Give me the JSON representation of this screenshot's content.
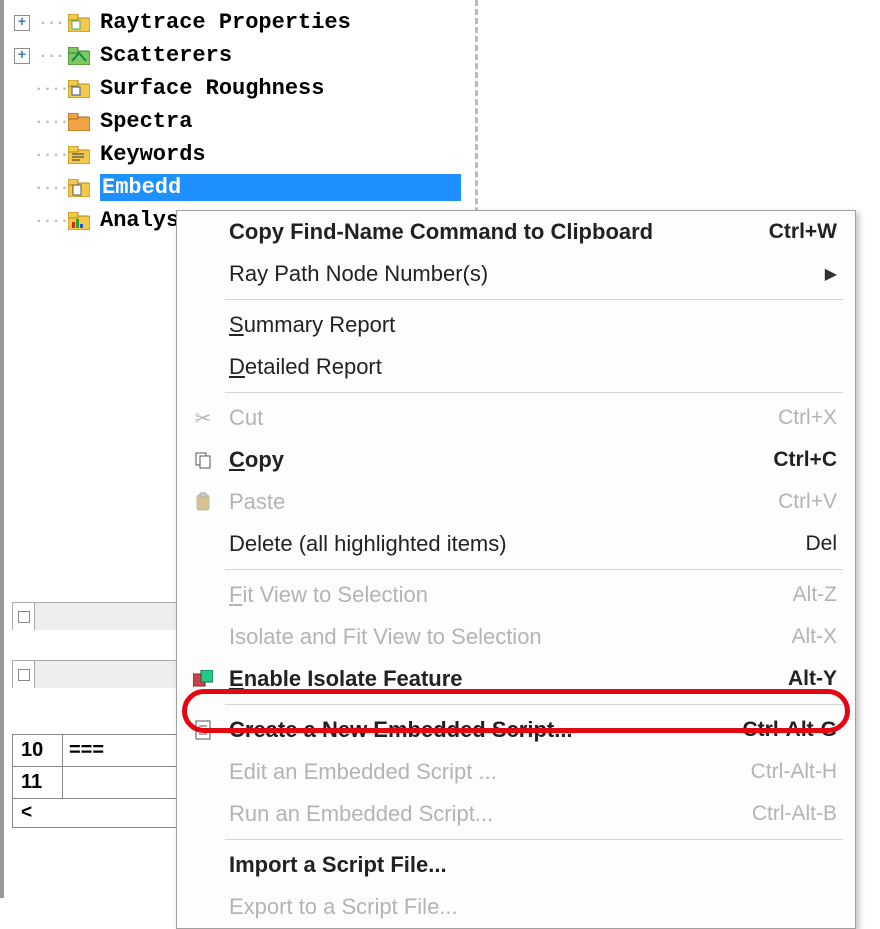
{
  "tree": {
    "items": [
      {
        "label": "Raytrace Properties",
        "expandable": true,
        "icon": "folder-yellow-doc"
      },
      {
        "label": "Scatterers",
        "expandable": true,
        "icon": "folder-green"
      },
      {
        "label": "Surface Roughness",
        "expandable": false,
        "icon": "folder-yellow-doc"
      },
      {
        "label": "Spectra",
        "expandable": false,
        "icon": "folder-orange"
      },
      {
        "label": "Keywords",
        "expandable": false,
        "icon": "folder-yellow-lines"
      },
      {
        "label": "Embedded Scripts",
        "expandable": false,
        "icon": "folder-script",
        "selected": true,
        "visible_label": "Embedd"
      },
      {
        "label": "Analysis",
        "expandable": false,
        "icon": "folder-chart",
        "visible_label": "Analys"
      }
    ]
  },
  "gutter": {
    "rows": [
      {
        "num": "10",
        "eq": "==="
      },
      {
        "num": "11",
        "eq": ""
      }
    ],
    "scroll_label": "<"
  },
  "context_menu": {
    "groups": [
      [
        {
          "label": "Copy Find-Name Command to Clipboard",
          "shortcut": "Ctrl+W",
          "bold": true,
          "icon": ""
        },
        {
          "label": "Ray Path Node Number(s)",
          "shortcut": "",
          "submenu": true,
          "icon": ""
        }
      ],
      [
        {
          "label": "Summary Report",
          "underline": "S",
          "icon": ""
        },
        {
          "label": "Detailed Report",
          "underline": "D",
          "icon": ""
        }
      ],
      [
        {
          "label": "Cut",
          "shortcut": "Ctrl+X",
          "disabled": true,
          "icon": "scissors"
        },
        {
          "label": "Copy",
          "shortcut": "Ctrl+C",
          "bold": true,
          "icon": "copy",
          "underline": "C"
        },
        {
          "label": "Paste",
          "shortcut": "Ctrl+V",
          "disabled": true,
          "icon": "paste"
        },
        {
          "label": "Delete (all highlighted items)",
          "shortcut": "Del",
          "icon": ""
        }
      ],
      [
        {
          "label": "Fit View to Selection",
          "shortcut": "Alt-Z",
          "disabled": true,
          "underline": "F"
        },
        {
          "label": "Isolate and Fit View to Selection",
          "shortcut": "Alt-X",
          "disabled": true
        },
        {
          "label": "Enable Isolate Feature",
          "shortcut": "Alt-Y",
          "bold": true,
          "icon": "isolate",
          "underline": "E"
        }
      ],
      [
        {
          "label": "Create a New Embedded Script...",
          "shortcut": "Ctrl-Alt-G",
          "bold": true,
          "icon": "doc",
          "highlighted": true
        },
        {
          "label": "Edit an Embedded Script ...",
          "shortcut": "Ctrl-Alt-H",
          "disabled": true
        },
        {
          "label": "Run an Embedded Script...",
          "shortcut": "Ctrl-Alt-B",
          "disabled": true
        }
      ],
      [
        {
          "label": "Import a Script File...",
          "bold": true
        },
        {
          "label": "Export to a Script File...",
          "disabled": true
        }
      ]
    ]
  }
}
